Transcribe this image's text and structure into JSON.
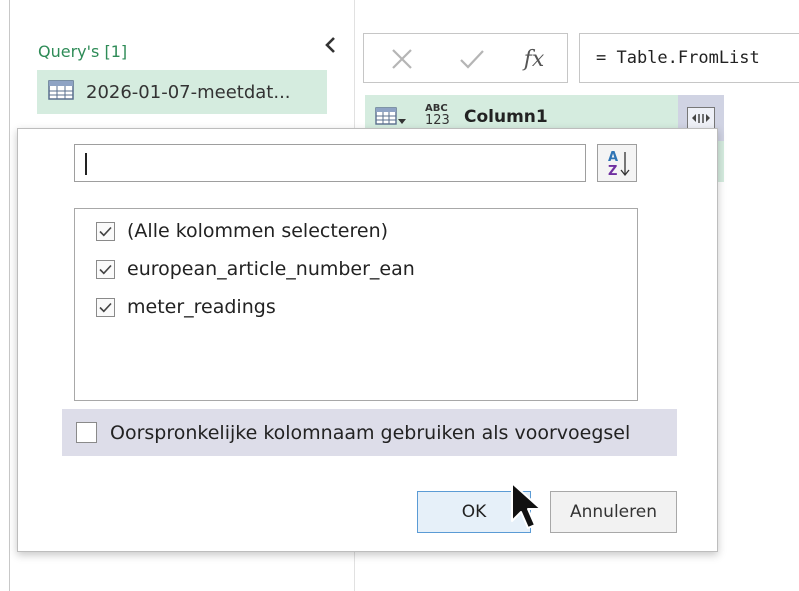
{
  "queries": {
    "header": "Query's [1]",
    "items": [
      {
        "label": "2026-01-07-meetdat..."
      }
    ]
  },
  "formula_bar": {
    "fx_label": "fx",
    "formula": "= Table.FromList"
  },
  "column_header": {
    "type_top": "ABC",
    "type_bottom": "123",
    "name": "Column1"
  },
  "expand_popup": {
    "search": {
      "value": "",
      "placeholder": ""
    },
    "columns": [
      {
        "label": "(Alle kolommen selecteren)",
        "checked": true
      },
      {
        "label": "european_article_number_ean",
        "checked": true
      },
      {
        "label": "meter_readings",
        "checked": true
      }
    ],
    "prefix_option": {
      "label": "Oorspronkelijke kolomnaam gebruiken als voorvoegsel",
      "checked": false
    },
    "ok_label": "OK",
    "cancel_label": "Annuleren"
  },
  "colors": {
    "accent_green": "#2e8b57",
    "selected_row": "#d5ecdf",
    "prefix_row_bg": "#dddde9",
    "ok_border": "#5b9bd5"
  }
}
